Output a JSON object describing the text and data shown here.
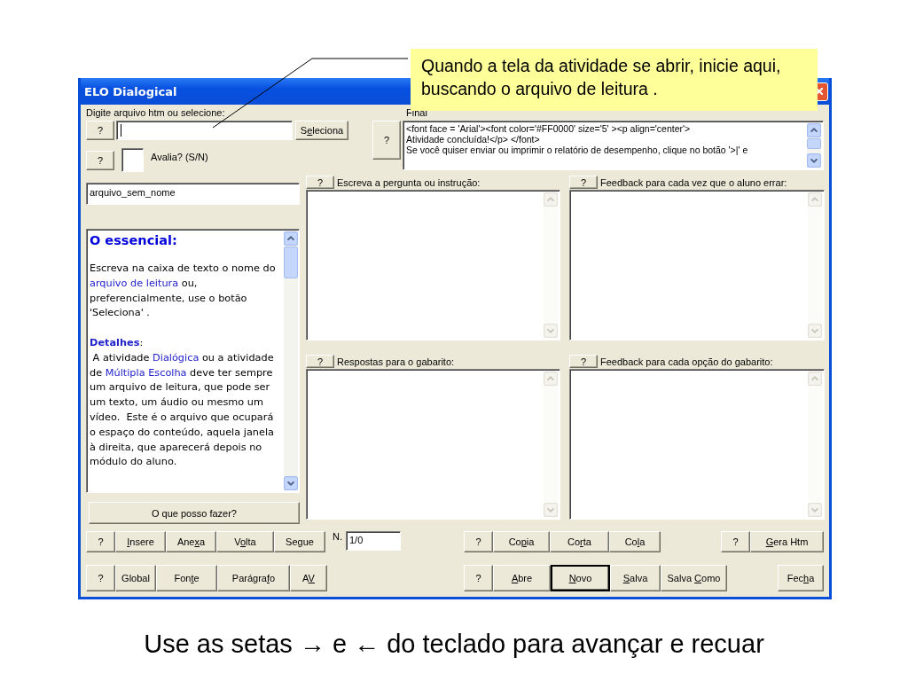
{
  "slide": {
    "callout": "Quando a tela da atividade se abrir, inicie aqui, buscando o arquivo de leitura .",
    "caption": "Use as setas → e ← do teclado para avançar e recuar"
  },
  "window": {
    "title": "ELO Dialogical"
  },
  "file": {
    "label": "Digite arquivo htm ou selecione:",
    "help": "?",
    "select_button": {
      "pre": "S",
      "key": "e",
      "post": "leciona"
    }
  },
  "evaluate": {
    "help": "?",
    "label": "Avalia? (S/N)"
  },
  "name_field": {
    "value": "arquivo_sem_nome"
  },
  "help_box": {
    "blocks": [
      {
        "kind": "heading",
        "text": "O essencial:"
      },
      {
        "kind": "paragraph",
        "parts": [
          {
            "text": "Escreva na caixa de texto o nome do ",
            "link": false
          },
          {
            "text": "arquivo de leitura",
            "link": true
          },
          {
            "text": " ou, preferencialmente, use o botão 'Seleciona' .",
            "link": false
          }
        ]
      },
      {
        "kind": "subheading",
        "parts": [
          {
            "text": "Detalhes",
            "link": true
          },
          {
            "text": ":",
            "link": false
          }
        ]
      },
      {
        "kind": "paragraph",
        "parts": [
          {
            "text": " A atividade ",
            "link": false
          },
          {
            "text": "Dialógica",
            "link": true
          },
          {
            "text": " ou a atividade de ",
            "link": false
          },
          {
            "text": "Múltipla Escolha",
            "link": true
          },
          {
            "text": " deve ter sempre um arquivo de leitura, que pode ser um texto, um áudio ou mesmo um vídeo.  Este é o arquivo que ocupará o espaço do conteúdo, aquela janela à direita, que aparecerá depois no módulo do aluno.",
            "link": false
          }
        ]
      }
    ]
  },
  "what_button": "O que posso fazer?",
  "final": {
    "label": "Final",
    "help": "?",
    "lines": [
      "<font face = 'Arial'><font color='#FF0000' size='5' ><p align='center'>",
      "Atividade concluída!</p> </font>",
      "Se você quiser enviar ou imprimir o relatório de desempenho, clique no botão '>|' e"
    ]
  },
  "panels": [
    {
      "help": "?",
      "label": "Escreva a pergunta ou instrução:"
    },
    {
      "help": "?",
      "label": "Feedback para cada vez que o aluno errar:"
    },
    {
      "help": "?",
      "label": "Respostas para o gabarito:"
    },
    {
      "help": "?",
      "label": "Feedback para cada opção do gabarito:"
    }
  ],
  "counter": {
    "label": "N.",
    "value": "1/0"
  },
  "toolbar_rows": [
    [
      [
        {
          "label": {
            "pre": "?"
          },
          "default": false
        },
        {
          "label": {
            "key": "I",
            "post": "nsere"
          },
          "default": false
        },
        {
          "label": {
            "pre": "Ane",
            "key": "x",
            "post": "a"
          },
          "default": false
        },
        {
          "label": {
            "pre": "V",
            "key": "o",
            "post": "lta"
          },
          "default": false
        },
        {
          "label": {
            "pre": "Se",
            "key": "g",
            "post": "ue"
          },
          "default": false
        }
      ],
      [
        {
          "label": {
            "pre": "?"
          },
          "default": false
        },
        {
          "label": {
            "pre": "Co",
            "key": "p",
            "post": "ia"
          },
          "default": false
        },
        {
          "label": {
            "pre": "Co",
            "key": "r",
            "post": "ta"
          },
          "default": false
        },
        {
          "label": {
            "pre": "Co",
            "key": "l",
            "post": "a"
          },
          "default": false
        }
      ],
      [
        {
          "label": {
            "pre": "?"
          },
          "default": false
        },
        {
          "label": {
            "key": "G",
            "post": "era Htm"
          },
          "default": false
        }
      ]
    ],
    [
      [
        {
          "label": {
            "pre": "?"
          },
          "default": false
        },
        {
          "label": {
            "pre": "Global"
          },
          "default": false
        },
        {
          "label": {
            "pre": "Fon",
            "key": "t",
            "post": "e"
          },
          "default": false
        },
        {
          "label": {
            "pre": "Parágra",
            "key": "f",
            "post": "o"
          },
          "default": false
        },
        {
          "label": {
            "pre": "A",
            "key": "V"
          },
          "default": false
        }
      ],
      [
        {
          "label": {
            "pre": "?"
          },
          "default": false
        },
        {
          "label": {
            "key": "A",
            "post": "bre"
          },
          "default": false
        },
        {
          "label": {
            "key": "N",
            "post": "ovo"
          },
          "default": true
        },
        {
          "label": {
            "key": "S",
            "post": "alva"
          },
          "default": false
        },
        {
          "label": {
            "pre": "Salva ",
            "key": "C",
            "post": "omo"
          },
          "default": false
        }
      ],
      [
        {
          "label": {
            "pre": "Fec",
            "key": "h",
            "post": "a"
          },
          "default": false
        }
      ]
    ]
  ]
}
